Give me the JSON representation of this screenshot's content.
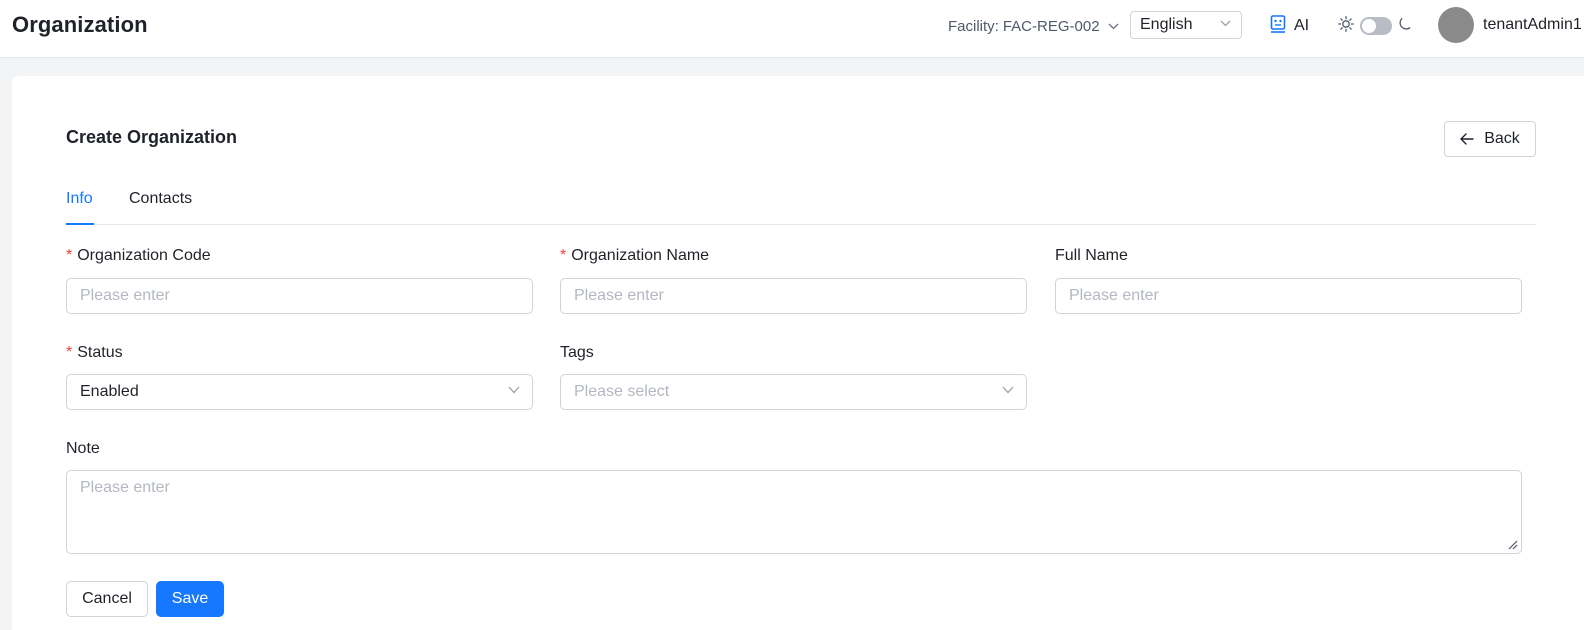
{
  "header": {
    "title": "Organization",
    "facility_label": "Facility:",
    "facility_value": "FAC-REG-002",
    "language": "English",
    "ai_label": "AI",
    "username": "tenantAdmin1",
    "icons": [
      "chevron-down-icon",
      "robot-icon",
      "sun-icon",
      "moon-icon",
      "avatar"
    ]
  },
  "page": {
    "title": "Create Organization",
    "back_label": "Back",
    "tabs": [
      {
        "label": "Info",
        "active": true
      },
      {
        "label": "Contacts",
        "active": false
      }
    ]
  },
  "form": {
    "org_code": {
      "label": "Organization Code",
      "required": "*",
      "placeholder": "Please enter",
      "value": ""
    },
    "org_name": {
      "label": "Organization Name",
      "required": "*",
      "placeholder": "Please enter",
      "value": ""
    },
    "full_name": {
      "label": "Full Name",
      "placeholder": "Please enter",
      "value": ""
    },
    "status": {
      "label": "Status",
      "required": "*",
      "value": "Enabled"
    },
    "tags": {
      "label": "Tags",
      "placeholder": "Please select"
    },
    "note": {
      "label": "Note",
      "placeholder": "Please enter",
      "value": ""
    }
  },
  "actions": {
    "cancel_label": "Cancel",
    "save_label": "Save"
  },
  "colors": {
    "accent": "#1677ff",
    "required": "#f53f3f",
    "background": "#f3f4f6"
  }
}
